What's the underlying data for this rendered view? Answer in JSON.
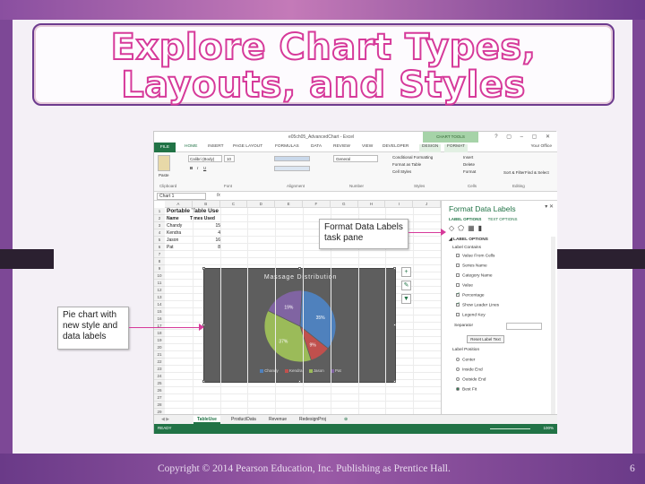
{
  "slide": {
    "title_line1": "Explore Chart Types,",
    "title_line2": "Layouts, and Styles",
    "footer": "Copyright © 2014 Pearson Education, Inc. Publishing as Prentice Hall.",
    "page_number": "6"
  },
  "callouts": {
    "task_pane": "Format Data Labels task pane",
    "pie_chart": "Pie chart with new style and data labels"
  },
  "excel": {
    "document_title": "e05ch05_AdvancedChart - Excel",
    "context_tab_group": "CHART TOOLS",
    "tabs": [
      "FILE",
      "HOME",
      "INSERT",
      "PAGE LAYOUT",
      "FORMULAS",
      "DATA",
      "REVIEW",
      "VIEW",
      "DEVELOPER",
      "DESIGN",
      "FORMAT"
    ],
    "user": "Your Office",
    "ribbon": {
      "font_name": "Calibri (Body)",
      "font_size": "10",
      "number_format": "General",
      "conditional_formatting": "Conditional Formatting",
      "format_as_table": "Format as Table",
      "cell_styles": "Cell Styles",
      "insert": "Insert",
      "delete": "Delete",
      "format": "Format",
      "sort_filter": "Sort & Filter",
      "find_select": "Find & Select",
      "groups": [
        "Clipboard",
        "Font",
        "Alignment",
        "Number",
        "Styles",
        "Cells",
        "Editing"
      ]
    },
    "name_box": "Chart 1",
    "fx_label": "fx",
    "columns": [
      "A",
      "B",
      "C",
      "D",
      "E",
      "F",
      "G",
      "H",
      "I",
      "J"
    ],
    "rows": [
      "1",
      "2",
      "3",
      "4",
      "5",
      "6",
      "7",
      "8",
      "9",
      "10",
      "11",
      "12",
      "13",
      "14",
      "15",
      "16",
      "17",
      "18",
      "19",
      "20",
      "21",
      "22",
      "23",
      "24",
      "25",
      "26",
      "27",
      "28",
      "29"
    ],
    "table": {
      "title": "Portable Table Use",
      "headers": [
        "Name",
        "Times Used"
      ],
      "rows": [
        {
          "name": "Chandy",
          "value": "15"
        },
        {
          "name": "Kendra",
          "value": "4"
        },
        {
          "name": "Jason",
          "value": "16"
        },
        {
          "name": "Pat",
          "value": "8"
        }
      ]
    },
    "sheet_tabs": [
      "TableUse",
      "ProductData",
      "Revenue",
      "RedesignProj"
    ],
    "status": "READY",
    "zoom": "100%"
  },
  "chart_data": {
    "type": "pie",
    "title": "Massage Distribution",
    "categories": [
      "Chandy",
      "Kendra",
      "Jason",
      "Pat"
    ],
    "values": [
      15,
      4,
      16,
      8
    ],
    "data_labels": [
      "35%",
      "9%",
      "37%",
      "19%"
    ],
    "colors": [
      "#4f81bd",
      "#c0504d",
      "#9bbb59",
      "#8064a2"
    ],
    "legend": "bottom"
  },
  "task_pane": {
    "title": "Format Data Labels",
    "tab_label_options": "LABEL OPTIONS",
    "tab_text_options": "TEXT OPTIONS",
    "section": "LABEL OPTIONS",
    "contains_heading": "Label Contains",
    "contains": [
      {
        "label": "Value From Cells",
        "checked": false
      },
      {
        "label": "Series Name",
        "checked": false
      },
      {
        "label": "Category Name",
        "checked": false
      },
      {
        "label": "Value",
        "checked": false
      },
      {
        "label": "Percentage",
        "checked": true
      },
      {
        "label": "Show Leader Lines",
        "checked": true
      },
      {
        "label": "Legend Key",
        "checked": false
      }
    ],
    "separator_label": "Separator",
    "reset_button": "Reset Label Text",
    "position_heading": "Label Position",
    "positions": [
      {
        "label": "Center",
        "checked": false
      },
      {
        "label": "Inside End",
        "checked": false
      },
      {
        "label": "Outside End",
        "checked": false
      },
      {
        "label": "Best Fit",
        "checked": true
      }
    ]
  },
  "icons": [
    "paste-icon",
    "chart-elements-icon",
    "chart-styles-icon",
    "chart-filters-icon",
    "fill-line-icon",
    "effects-icon",
    "size-properties-icon",
    "label-options-icon",
    "close-icon"
  ]
}
